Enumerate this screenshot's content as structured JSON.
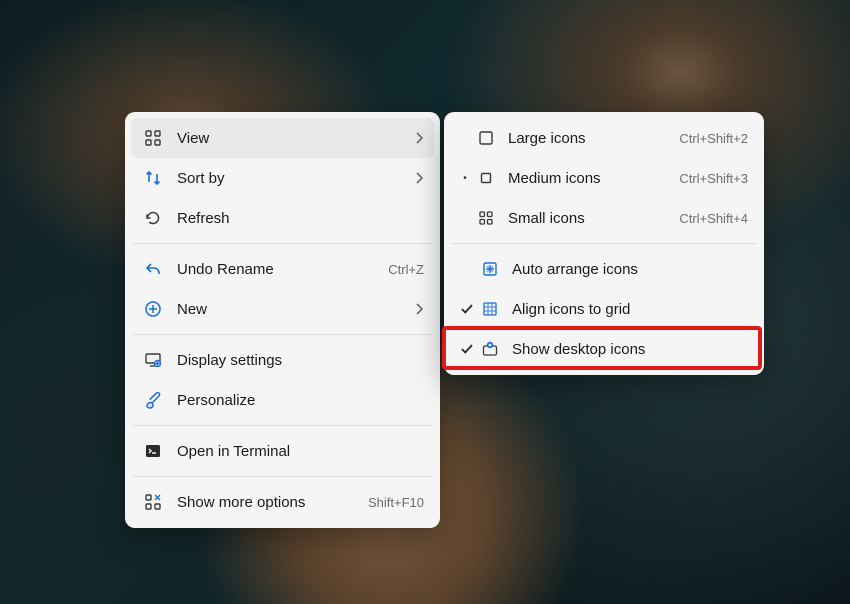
{
  "main_menu": {
    "view": {
      "label": "View"
    },
    "sort_by": {
      "label": "Sort by"
    },
    "refresh": {
      "label": "Refresh"
    },
    "undo": {
      "label": "Undo Rename",
      "accel": "Ctrl+Z"
    },
    "new": {
      "label": "New"
    },
    "display": {
      "label": "Display settings"
    },
    "personalize": {
      "label": "Personalize"
    },
    "terminal": {
      "label": "Open in Terminal"
    },
    "more": {
      "label": "Show more options",
      "accel": "Shift+F10"
    }
  },
  "view_submenu": {
    "large": {
      "label": "Large icons",
      "accel": "Ctrl+Shift+2"
    },
    "medium": {
      "label": "Medium icons",
      "accel": "Ctrl+Shift+3"
    },
    "small": {
      "label": "Small icons",
      "accel": "Ctrl+Shift+4"
    },
    "auto": {
      "label": "Auto arrange icons"
    },
    "align": {
      "label": "Align icons to grid"
    },
    "show": {
      "label": "Show desktop icons"
    }
  }
}
